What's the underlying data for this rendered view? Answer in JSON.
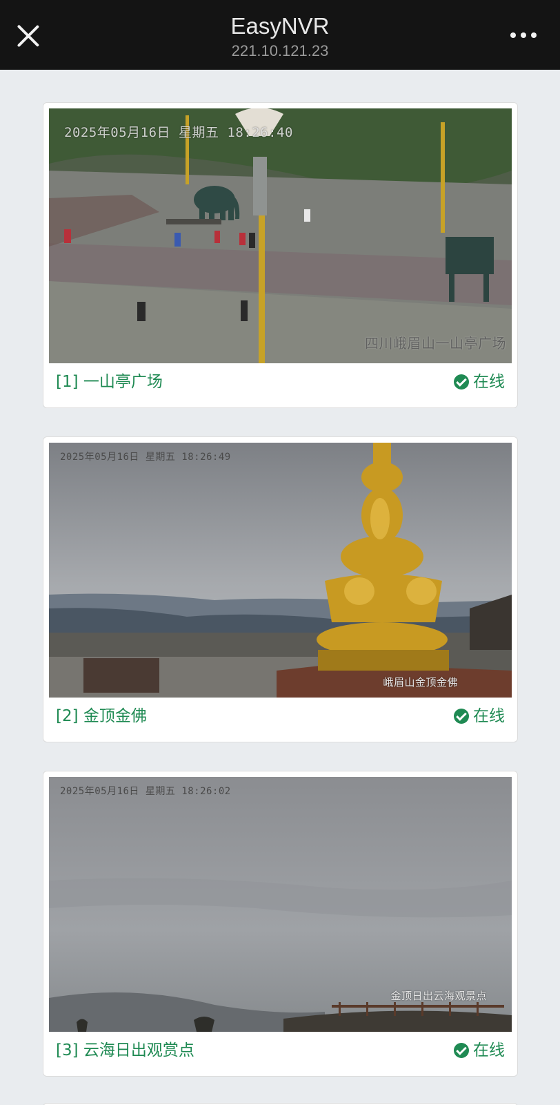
{
  "header": {
    "title": "EasyNVR",
    "subtitle": "221.10.121.23"
  },
  "channels": [
    {
      "name": "[1] 一山亭广场",
      "status": "在线",
      "osd_time": "2025年05月16日 星期五 18:26:40",
      "osd_location": "四川峨眉山一山亭广场"
    },
    {
      "name": "[2] 金顶金佛",
      "status": "在线",
      "osd_time": "2025年05月16日 星期五 18:26:49",
      "osd_location": "峨眉山金顶金佛"
    },
    {
      "name": "[3] 云海日出观赏点",
      "status": "在线",
      "osd_time": "2025年05月16日 星期五 18:26:02",
      "osd_location": "金顶日出云海观景点"
    }
  ],
  "colors": {
    "header_bg": "#141414",
    "page_bg": "#e9ecef",
    "online_green": "#1f8a53"
  },
  "icons": [
    "close-icon",
    "more-icon",
    "check-circle-icon"
  ]
}
